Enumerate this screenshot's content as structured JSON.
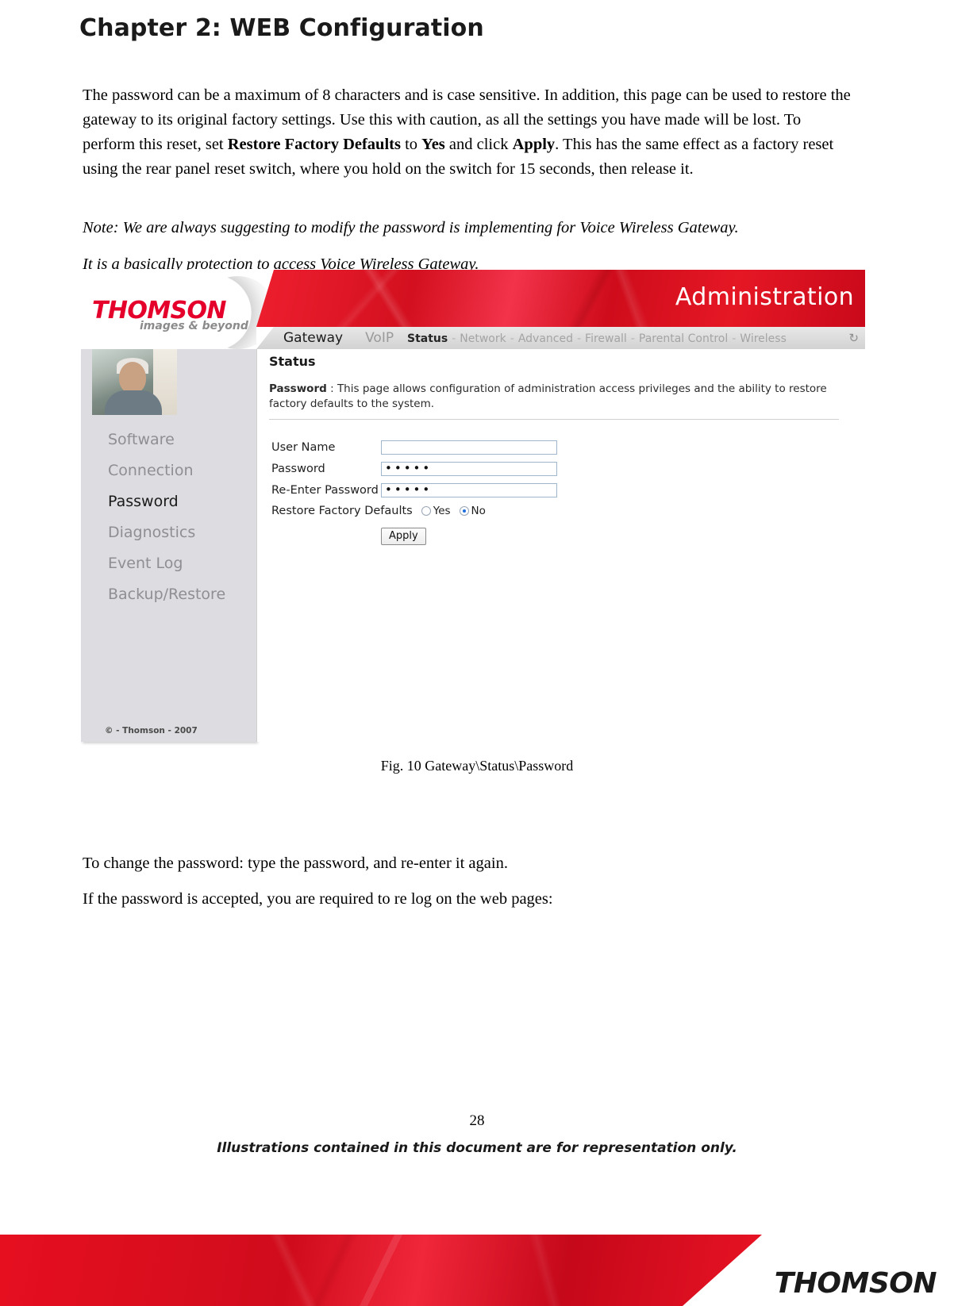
{
  "document": {
    "chapter_title": "Chapter 2: WEB Configuration",
    "paragraph_1_part1": "The password can be a maximum of 8 characters and is case sensitive. In addition, this page can be used to restore the gateway to its original factory settings. Use this with caution, as all the settings you have made will be lost. To perform this reset, set ",
    "paragraph_1_bold1": "Restore Factory Defaults",
    "paragraph_1_part2": " to ",
    "paragraph_1_bold2": "Yes",
    "paragraph_1_part3": " and click ",
    "paragraph_1_bold3": "Apply",
    "paragraph_1_part4": ". This has the same effect as a factory reset using the rear panel reset switch, where you hold on the switch for 15 seconds, then release it.",
    "note_line_1": "Note: We are always suggesting to modify the password is implementing for Voice Wireless Gateway.",
    "note_line_2": "It is a basically protection to access Voice Wireless Gateway.",
    "figure_caption": "Fig. 10 Gateway\\Status\\Password",
    "paragraph_after_1": "To change the password: type the password, and re-enter it again.",
    "paragraph_after_2": "If the password is accepted, you are required to re log on the web pages:",
    "page_number": "28",
    "footer_note": "Illustrations contained in this document are for representation only.",
    "footer_brand": "THOMSON"
  },
  "screenshot": {
    "logo": {
      "brand": "THOMSON",
      "tagline": "images & beyond"
    },
    "header": {
      "section_title": "Administration"
    },
    "nav": {
      "primary": [
        {
          "label": "Gateway",
          "active": true
        },
        {
          "label": "VoIP",
          "active": false
        }
      ],
      "secondary": [
        {
          "label": "Status",
          "active": true
        },
        {
          "label": "Network",
          "active": false
        },
        {
          "label": "Advanced",
          "active": false
        },
        {
          "label": "Firewall",
          "active": false
        },
        {
          "label": "Parental Control",
          "active": false
        },
        {
          "label": "Wireless",
          "active": false
        }
      ],
      "separator": "-",
      "refresh_icon": "refresh-icon",
      "refresh_glyph": "↻"
    },
    "sidebar": {
      "items": [
        {
          "label": "Software",
          "active": false
        },
        {
          "label": "Connection",
          "active": false
        },
        {
          "label": "Password",
          "active": true
        },
        {
          "label": "Diagnostics",
          "active": false
        },
        {
          "label": "Event Log",
          "active": false
        },
        {
          "label": "Backup/Restore",
          "active": false
        }
      ],
      "copyright": "© - Thomson - 2007"
    },
    "panel": {
      "heading": "Status",
      "desc_label": "Password",
      "desc_separator": ":",
      "desc_text": "This page allows configuration of administration access privileges and the ability to restore factory defaults to the system."
    },
    "form": {
      "fields": [
        {
          "label": "User Name",
          "value": ""
        },
        {
          "label": "Password",
          "value": "•••••"
        },
        {
          "label": "Re-Enter Password",
          "value": "•••••"
        }
      ],
      "restore_label": "Restore Factory Defaults",
      "restore_options": [
        {
          "label": "Yes",
          "selected": false
        },
        {
          "label": "No",
          "selected": true
        }
      ],
      "apply_label": "Apply"
    },
    "colors": {
      "brand_red": "#e4002b",
      "header_red": "#d3101f",
      "sidebar_bg": "#dddde1",
      "active_text": "#1a1a1a",
      "inactive_text": "#8e8e93",
      "radio_dot": "#1e6fd9"
    }
  }
}
